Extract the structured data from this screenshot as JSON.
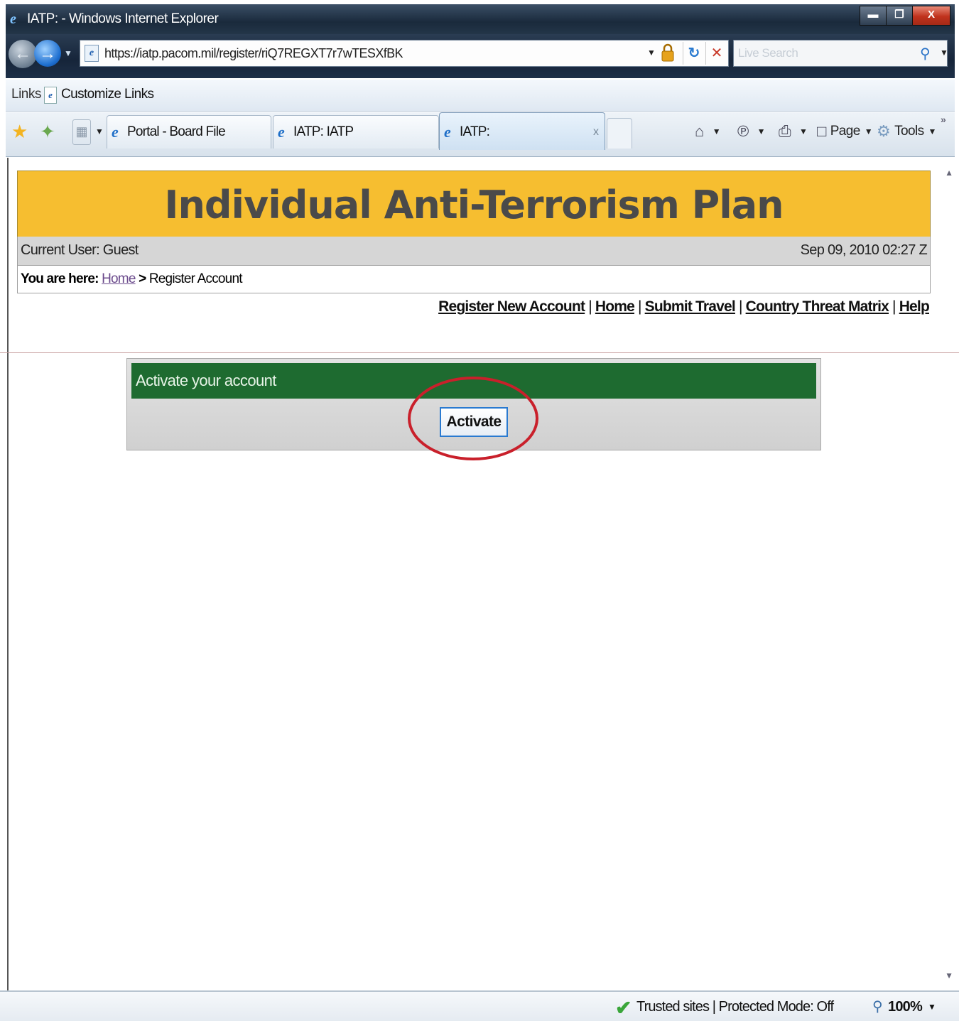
{
  "window": {
    "title": "IATP: - Windows Internet Explorer",
    "buttons": {
      "minimize": "▬",
      "restore": "❐",
      "close": "X"
    }
  },
  "address_bar": {
    "url": "https://iatp.pacom.mil/register/riQ7REGXT7r7wTESXfBK",
    "search_placeholder": "Live Search"
  },
  "links_bar": {
    "label": "Links",
    "customize": "Customize Links"
  },
  "tabs": [
    {
      "label": "Portal - Board File"
    },
    {
      "label": "IATP: IATP"
    },
    {
      "label": "IATP:",
      "active": true,
      "close": "x"
    }
  ],
  "command_bar": {
    "page": "Page",
    "tools": "Tools"
  },
  "page": {
    "banner_title": "Individual Anti-Terrorism Plan",
    "current_user": "Current User: Guest",
    "datetime": "Sep 09, 2010 02:27 Z",
    "breadcrumb": {
      "prefix": "You are here:",
      "home": "Home",
      "separator": ">",
      "current": "Register Account"
    },
    "top_links": [
      "Register New Account",
      "Home",
      "Submit Travel",
      "Country Threat Matrix",
      "Help"
    ],
    "link_separator": "|",
    "panel": {
      "title": "Activate your account",
      "button": "Activate"
    }
  },
  "status_bar": {
    "zone": "Trusted sites | Protected Mode: Off",
    "zoom": "100%"
  },
  "colors": {
    "banner": "#f6be30",
    "panel_header": "#1e6b30",
    "highlight": "#c9202b"
  }
}
